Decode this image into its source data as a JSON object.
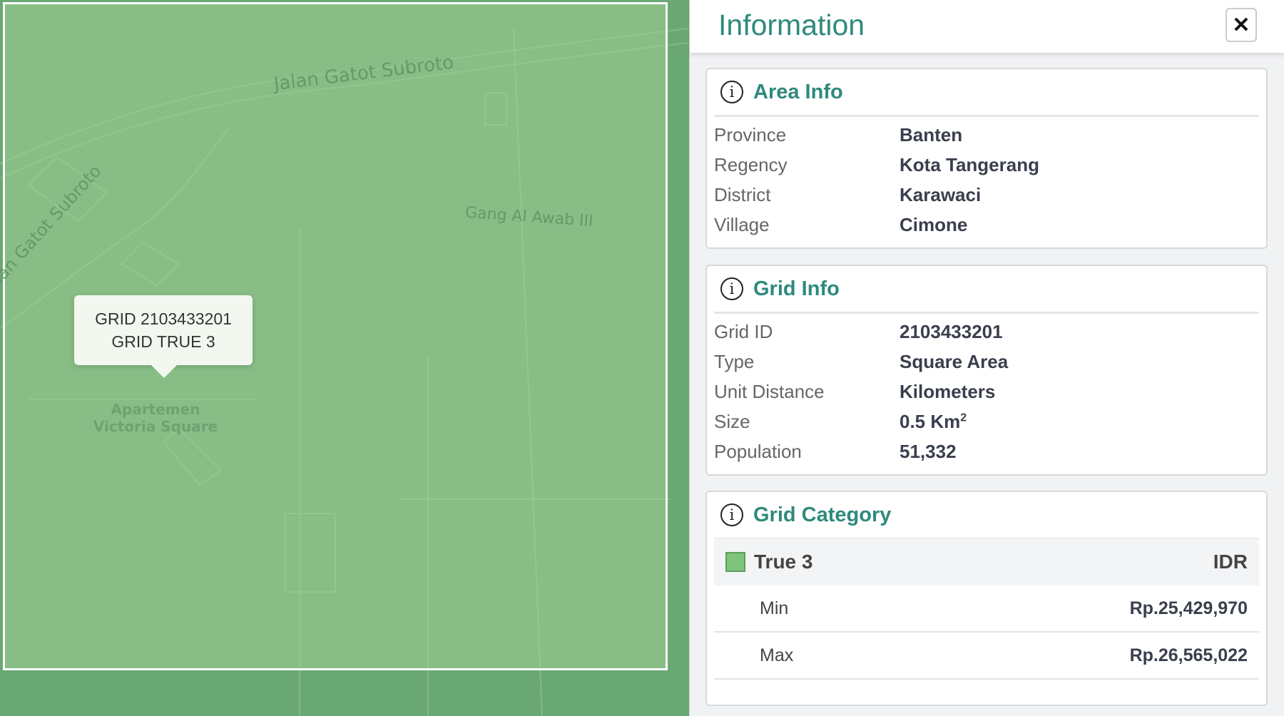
{
  "map": {
    "streets": [
      "Jalan Gatot Subroto",
      "Gang Al Awab III",
      "Jalan Gatot Subroto"
    ],
    "poi": "Apartemen\nVictoria Square",
    "tooltip": {
      "line1": "GRID 2103433201",
      "line2": "GRID TRUE 3"
    }
  },
  "panel": {
    "title": "Information",
    "close_icon": "close-icon",
    "area_info": {
      "title": "Area Info",
      "rows": [
        {
          "label": "Province",
          "value": "Banten"
        },
        {
          "label": "Regency",
          "value": "Kota Tangerang"
        },
        {
          "label": "District",
          "value": "Karawaci"
        },
        {
          "label": "Village",
          "value": "Cimone"
        }
      ]
    },
    "grid_info": {
      "title": "Grid Info",
      "rows": [
        {
          "label": "Grid ID",
          "value": "2103433201"
        },
        {
          "label": "Type",
          "value": "Square Area"
        },
        {
          "label": "Unit Distance",
          "value": "Kilometers"
        },
        {
          "label": "Size",
          "value": "0.5 Km",
          "sup": "2"
        },
        {
          "label": "Population",
          "value": "51,332"
        }
      ]
    },
    "grid_category": {
      "title": "Grid Category",
      "category": "True 3",
      "currency": "IDR",
      "swatch_color": "#7fc47c",
      "min_label": "Min",
      "min_value": "Rp.25,429,970",
      "max_label": "Max",
      "max_value": "Rp.26,565,022"
    }
  }
}
